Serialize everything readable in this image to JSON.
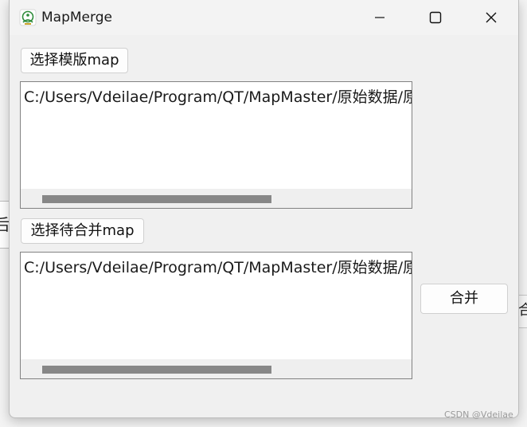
{
  "window": {
    "title": "MapMerge",
    "minimize_icon": "minimize-icon",
    "maximize_icon": "maximize-icon",
    "close_icon": "close-icon"
  },
  "template_section": {
    "button_label": "选择模版map",
    "path": "C:/Users/Vdeilae/Program/QT/MapMaster/原始数据/原",
    "scroll_position": 0.0,
    "scroll_visible_fraction": 0.62
  },
  "pending_section": {
    "button_label": "选择待合并map",
    "path": "C:/Users/Vdeilae/Program/QT/MapMaster/原始数据/原",
    "scroll_position": 0.0,
    "scroll_visible_fraction": 0.62
  },
  "merge_button": {
    "label": "合并"
  },
  "background_fragments": {
    "left_text": "后",
    "right_text": "合"
  },
  "watermark": "CSDN @Vdeilae",
  "colors": {
    "window_bg": "#f0f0f0",
    "scroll_thumb": "#878787",
    "icon_green": "#2e8b3a"
  }
}
